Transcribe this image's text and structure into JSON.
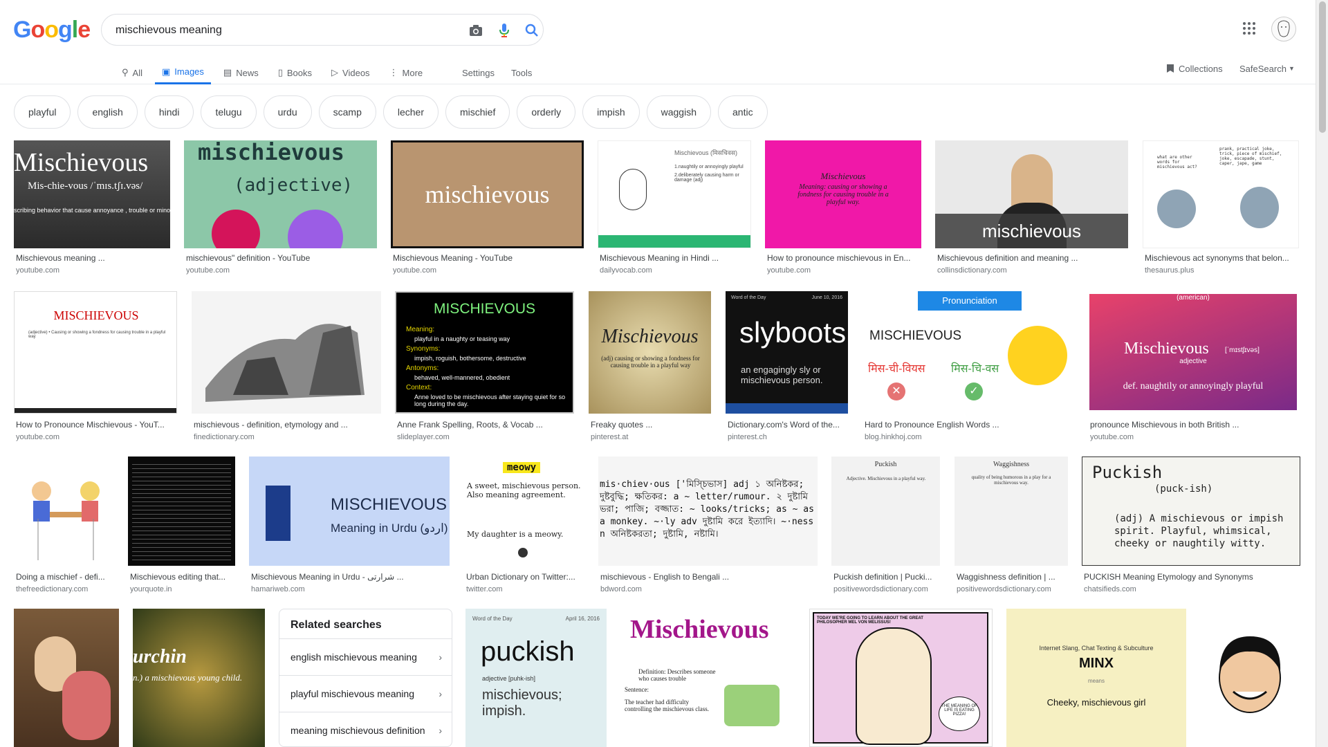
{
  "logo": "Google",
  "search": {
    "query": "mischievous meaning"
  },
  "tabs": [
    {
      "label": "All",
      "icon": "search-icon"
    },
    {
      "label": "Images",
      "icon": "image-icon",
      "active": true
    },
    {
      "label": "News",
      "icon": "news-icon"
    },
    {
      "label": "Books",
      "icon": "book-icon"
    },
    {
      "label": "Videos",
      "icon": "video-icon"
    },
    {
      "label": "More",
      "icon": "more-icon"
    }
  ],
  "settings_label": "Settings",
  "tools_label": "Tools",
  "collections_label": "Collections",
  "safesearch_label": "SafeSearch",
  "chips": [
    "playful",
    "english",
    "hindi",
    "telugu",
    "urdu",
    "scamp",
    "lecher",
    "mischief",
    "orderly",
    "impish",
    "waggish",
    "antic"
  ],
  "row1": [
    {
      "title": "Mischievous meaning ...",
      "domain": "youtube.com",
      "img": {
        "big": "Mischievous",
        "small": "Mis-chie-vous  /ˈmɪs.tʃɪ.vəs/",
        "small2": "scribing behavior that cause annoyance , trouble or minor injury"
      }
    },
    {
      "title": "mischievous\" definition - YouTube",
      "domain": "youtube.com",
      "img": {
        "big": "mischievous",
        "small": "(adjective)"
      }
    },
    {
      "title": "Mischievous Meaning - YouTube",
      "domain": "youtube.com",
      "img": {
        "big": "mischievous"
      }
    },
    {
      "title": "Mischievous Meaning in Hindi ...",
      "domain": "dailyvocab.com",
      "img": {
        "big": "Mischievous (मिसचिवस)",
        "small": "1.naughtily or annoyingly playful",
        "small2": "2.deliberately causing harm or damage (adj)"
      }
    },
    {
      "title": "How to pronounce mischievous in En...",
      "domain": "youtube.com",
      "img": {
        "big": "Mischievous",
        "small": "Meaning: causing or showing a fondness for causing trouble in a playful way."
      }
    },
    {
      "title": "Mischievous definition and meaning ...",
      "domain": "collinsdictionary.com",
      "img": {
        "big": "mischievous"
      }
    },
    {
      "title": "Mischievous act synonyms that belon...",
      "domain": "thesaurus.plus",
      "img": {
        "big": "what are other words for mischievous act?",
        "small": "prank, practical joke, trick, piece of mischief, joke, escapade, stunt, caper, jape, game"
      }
    }
  ],
  "row2": [
    {
      "title": "How to Pronounce Mischievous - YouT...",
      "domain": "youtube.com",
      "img": {
        "big": "MISCHIEVOUS",
        "small": "(adjective)  • Causing or showing a fondness for causing trouble in a playful way"
      }
    },
    {
      "title": "mischievous - definition, etymology and ...",
      "domain": "finedictionary.com",
      "img": {}
    },
    {
      "title": "Anne Frank Spelling, Roots, & Vocab ...",
      "domain": "slideplayer.com",
      "img": {
        "big": "MISCHIEVOUS",
        "l1": "Meaning:",
        "l2": "playful in a naughty or teasing way",
        "l3": "Synonyms:",
        "l4": "impish, roguish, bothersome, destructive",
        "l5": "Antonyms:",
        "l6": "behaved, well-mannered, obedient",
        "l7": "Context:",
        "l8": "Anne loved to be mischievous after staying quiet for so long during the day."
      }
    },
    {
      "title": "Freaky quotes ...",
      "domain": "pinterest.at",
      "img": {
        "big": "Mischievous",
        "small": "(adj) causing or showing a fondness for causing trouble in a playful way"
      }
    },
    {
      "title": "Dictionary.com's Word of the...",
      "domain": "pinterest.ch",
      "img": {
        "big": "slyboots",
        "small": "an engagingly sly or mischievous person.",
        "tag": "Word of the Day",
        "date": "June 10, 2016"
      }
    },
    {
      "title": "Hard to Pronounce English Words ...",
      "domain": "blog.hinkhoj.com",
      "img": {
        "big": "MISCHIEVOUS",
        "banner": "Pronunciation",
        "wrong": "मिस-ची-वियस",
        "right": "मिस-चि-वस"
      }
    },
    {
      "title": "pronounce Mischievous in both British ...",
      "domain": "youtube.com",
      "img": {
        "big": "Mischievous",
        "small": "def. naughtily or annoyingly playful",
        "tag": "(american)",
        "ipa": "[ˈmɪstʃɪvəs]",
        "pos": "adjective"
      }
    }
  ],
  "row3": [
    {
      "title": "Doing a mischief - defi...",
      "domain": "thefreedictionary.com",
      "img": {}
    },
    {
      "title": "Mischievous editing that...",
      "domain": "yourquote.in",
      "img": {}
    },
    {
      "title": "Mischievous Meaning in Urdu - شرارتی ...",
      "domain": "hamariweb.com",
      "img": {
        "big": "MISCHIEVOUS",
        "small": "Meaning in Urdu (اردو)"
      }
    },
    {
      "title": "Urban Dictionary on Twitter:...",
      "domain": "twitter.com",
      "img": {
        "big": "meowy",
        "small": "A sweet, mischievous person. Also meaning agreement.",
        "small2": "My daughter is a meowy."
      }
    },
    {
      "title": "mischievous - English to Bengali ...",
      "domain": "bdword.com",
      "img": {
        "big": "mis·chiev·ous ['মিস্চিভাস] adj ১ অনিষ্টকর; দুষ্টবুদ্ধি; ক্ষতিকর: a ~ letter/rumour. ২ দুষ্টামি ভরা; পাজি; বজ্জাত: ~ looks/tricks; as ~ as a monkey. ~·ly adv দুষ্টামি করে ইত্যাদি। ~·ness n অনিষ্টকরতা; দুষ্টামি, নষ্টামি।"
      }
    },
    {
      "title": "Puckish definition | Pucki...",
      "domain": "positivewordsdictionary.com",
      "img": {
        "big": "Puckish",
        "small": "Adjective. Mischievous in a playful way."
      }
    },
    {
      "title": "Waggishness definition | ...",
      "domain": "positivewordsdictionary.com",
      "img": {
        "big": "Waggishness",
        "small": "quality of being humorous in a play for a mischievous way."
      }
    },
    {
      "title": "PUCKISH Meaning Etymology and Synonyms",
      "domain": "chatsifieds.com",
      "img": {
        "big": "Puckish",
        "small": "(puck-ish)",
        "small2": "(adj) A mischievous or impish spirit. Playful, whimsical, cheeky or naughtily witty."
      }
    }
  ],
  "related": {
    "title": "Related searches",
    "items": [
      "english mischievous meaning",
      "playful mischievous meaning",
      "meaning mischievous definition"
    ]
  },
  "row4": [
    {
      "img": {}
    },
    {
      "img": {
        "big": "urchin",
        "small": "n.) a mischievous young child."
      }
    },
    {
      "img": {
        "big": "puckish",
        "small": "adjective [puhk-ish]",
        "small2": "mischievous; impish.",
        "tag": "Word of the Day",
        "date": "April 16, 2016"
      }
    },
    {
      "img": {
        "big": "Mischievous",
        "small": "Definition: Describes someone who causes trouble",
        "small2": "Sentence:",
        "small3": "The teacher had difficulty controlling the mischievous class."
      }
    },
    {
      "img": {
        "big": "TODAY WE'RE GOING TO LEARN ABOUT THE GREAT PHILOSOPHER MEL VON MELISSUS!",
        "small": "THE MEANING OF LIFE IS EATING PIZZA!"
      }
    },
    {
      "img": {
        "big": "MINX",
        "small": "Internet Slang, Chat Texting & Subculture",
        "small2": "Cheeky, mischievous girl",
        "small3": "means"
      }
    },
    {
      "img": {}
    }
  ]
}
